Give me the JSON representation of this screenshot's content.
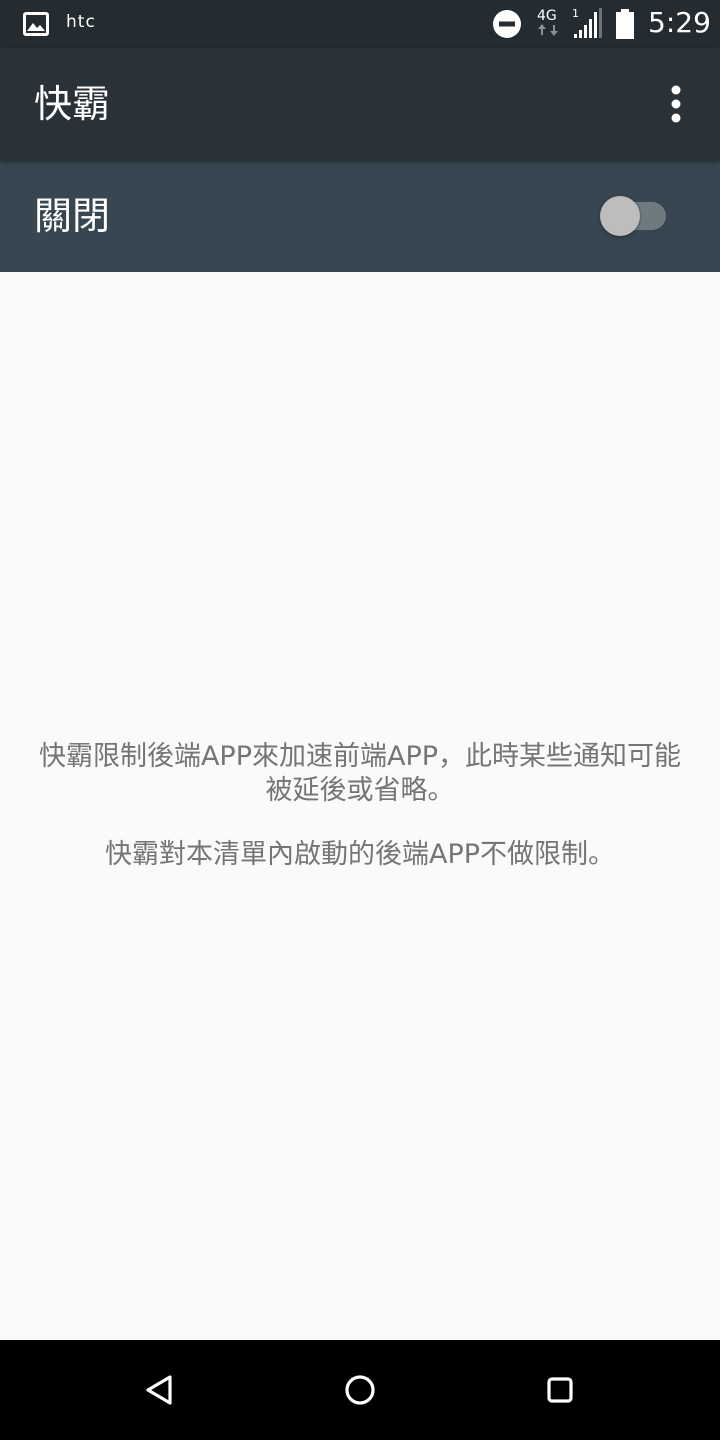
{
  "status_bar": {
    "carrier": "htc",
    "network": "4G",
    "sim_slot": "1",
    "time": "5:29",
    "icons": [
      "gallery-icon",
      "do-not-disturb-icon",
      "network-4g-icon",
      "signal-icon",
      "battery-icon"
    ]
  },
  "toolbar": {
    "title": "快霸",
    "overflow_icon": "more-vert-icon"
  },
  "switch_bar": {
    "label": "關閉",
    "switch_on": false
  },
  "content": {
    "message_1": "快霸限制後端APP來加速前端APP，此時某些通知可能被延後或省略。",
    "message_2": "快霸對本清單內啟動的後端APP不做限制。"
  },
  "nav_bar": {
    "icons": [
      "back-icon",
      "home-icon",
      "recents-icon"
    ]
  },
  "colors": {
    "status_bar": "#242b31",
    "toolbar": "#293238",
    "switch_bar": "#374650",
    "background": "#fafafa",
    "message_text": "#757575",
    "nav_bar": "#000000"
  }
}
